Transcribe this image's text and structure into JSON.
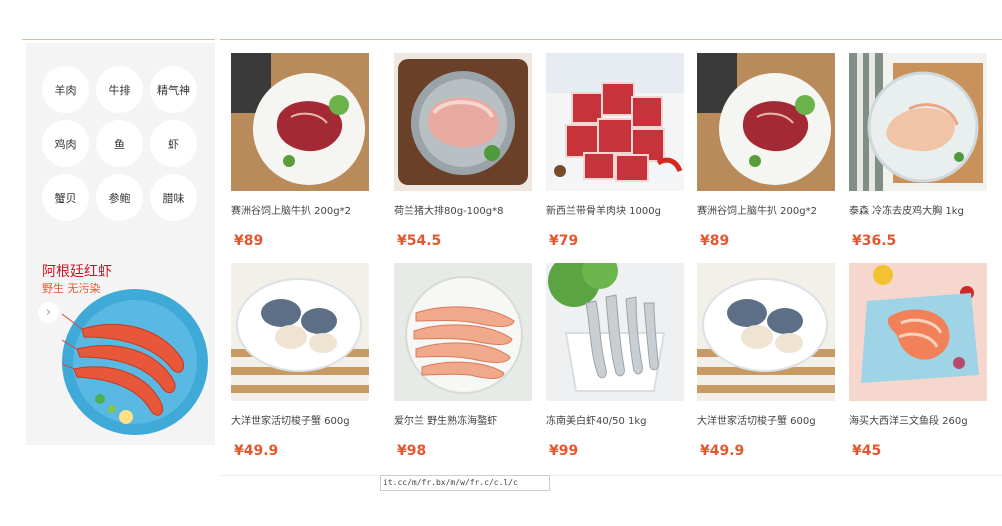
{
  "sidebar": {
    "categories": [
      "羊肉",
      "牛排",
      "精气神",
      "鸡肉",
      "鱼",
      "虾",
      "蟹贝",
      "参鲍",
      "腊味"
    ],
    "promo": {
      "title": "阿根廷红虾",
      "subtitle": "野生 无污染",
      "arrow": "›"
    }
  },
  "products": [
    {
      "title": "赛洲谷饲上脑牛扒 200g*2",
      "price": "¥89",
      "image": "beef-steak"
    },
    {
      "title": "荷兰猪大排80g-100g*8",
      "price": "¥54.5",
      "image": "pork-chop"
    },
    {
      "title": "新西兰带骨羊肉块 1000g",
      "price": "¥79",
      "image": "lamb-cubes"
    },
    {
      "title": "赛洲谷饲上脑牛扒 200g*2",
      "price": "¥89",
      "image": "beef-steak"
    },
    {
      "title": "泰森 冷冻去皮鸡大胸 1kg",
      "price": "¥36.5",
      "image": "chicken-breast"
    },
    {
      "title": "大洋世家活切梭子蟹 600g",
      "price": "¥49.9",
      "image": "crab"
    },
    {
      "title": "爱尔兰 野生熟冻海螯虾",
      "price": "¥98",
      "image": "langoustine"
    },
    {
      "title": "冻南美白虾40/50 1kg",
      "price": "¥99",
      "image": "white-shrimp"
    },
    {
      "title": "大洋世家活切梭子蟹 600g",
      "price": "¥49.9",
      "image": "crab"
    },
    {
      "title": "海买大西洋三文鱼段 260g",
      "price": "¥45",
      "image": "salmon"
    }
  ],
  "status_url": "it.cc/m/fr.bx/m/w/fr.c/c.l/c"
}
